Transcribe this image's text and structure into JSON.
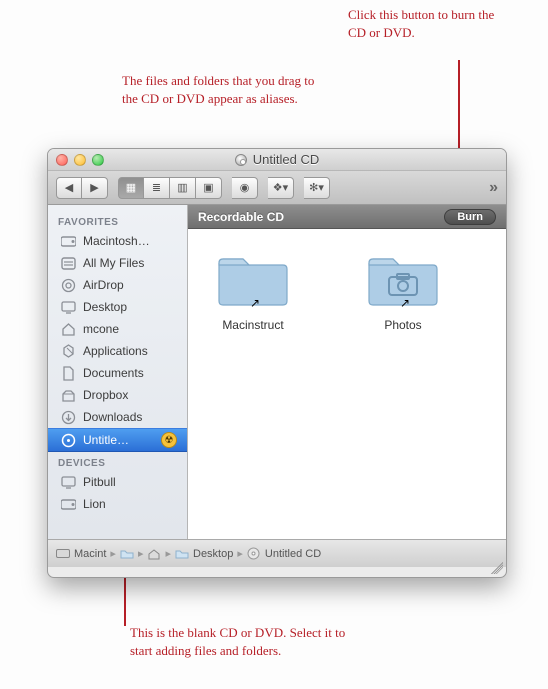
{
  "annotations": {
    "top_right": "Click this button to burn the CD or DVD.",
    "top_mid": "The files and folders that you drag to the CD or DVD appear as aliases.",
    "bottom": "This is the blank CD or DVD. Select it to start adding files and folders."
  },
  "window": {
    "title": "Untitled CD"
  },
  "bar": {
    "label": "Recordable CD",
    "burn": "Burn"
  },
  "sidebar": {
    "favorites_header": "FAVORITES",
    "items": [
      "Macintosh…",
      "All My Files",
      "AirDrop",
      "Desktop",
      "mcone",
      "Applications",
      "Documents",
      "Dropbox",
      "Downloads",
      "Untitle…"
    ],
    "burn_symbol": "☢",
    "devices_header": "DEVICES",
    "devices": [
      "Pitbull",
      "Lion"
    ]
  },
  "folders": {
    "f1": "Macinstruct",
    "f2": "Photos"
  },
  "path": {
    "c1": "Macint",
    "c2": "",
    "c3": "Desktop",
    "c4": "Untitled CD"
  }
}
